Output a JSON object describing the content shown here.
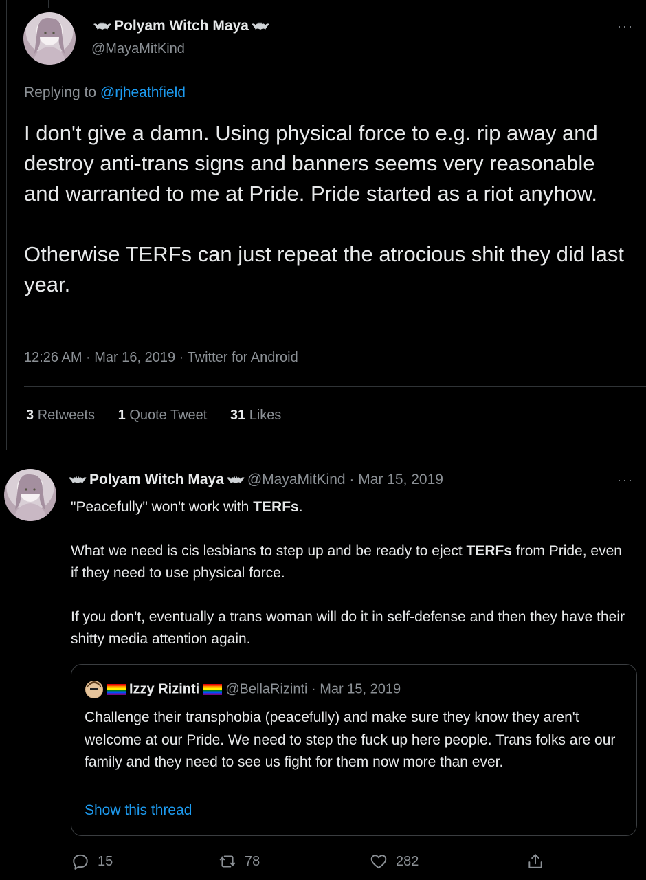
{
  "main_tweet": {
    "display_name": "Polyam Witch Maya",
    "handle": "@MayaMitKind",
    "more_label": "···",
    "replying_to_prefix": "Replying to",
    "replying_to_handle": "@rjheathfield",
    "text_p1": "I don't give a damn. Using physical force to e.g. rip away and destroy anti-trans signs and banners seems very reasonable and warranted to me at Pride. Pride started as a riot anyhow.",
    "text_p2": "Otherwise TERFs can just repeat the atrocious shit they did last year.",
    "meta": "12:26 AM · Mar 16, 2019 · Twitter for Android",
    "stats": {
      "retweets_count": "3",
      "retweets_label": "Retweets",
      "quotes_count": "1",
      "quotes_label": "Quote Tweet",
      "likes_count": "31",
      "likes_label": "Likes"
    }
  },
  "second_tweet": {
    "display_name": "Polyam Witch Maya",
    "handle_date": "@MayaMitKind · Mar 15, 2019",
    "more_label": "···",
    "line1_pre": "\"Peacefully\" won't work with ",
    "line1_bold": "TERFs",
    "line1_post": ".",
    "p2_pre": "What we need is cis lesbians to step up and be ready to eject ",
    "p2_bold": "TERFs",
    "p2_post": " from Pride, even if they need to use physical force.",
    "p3": "If you don't, eventually a trans woman will do it in self-defense and then they have their shitty media attention again.",
    "quote": {
      "name": "Izzy Rizinti",
      "handle_date": "@BellaRizinti · Mar 15, 2019",
      "text": "Challenge their transphobia (peacefully) and make sure they know they aren't welcome at our Pride.  We need to step the fuck up here people. Trans folks are our family and they need to see us fight for them now more than ever.",
      "show_thread": "Show this thread"
    },
    "actions": {
      "replies": "15",
      "retweets": "78",
      "likes": "282"
    }
  },
  "icons": {
    "reply": "reply-icon",
    "retweet": "retweet-icon",
    "like": "heart-icon",
    "share": "share-icon",
    "more": "more-icon"
  },
  "colors": {
    "background": "#000000",
    "text": "#e7e9ea",
    "muted": "#8b9095",
    "link": "#1d9bf0",
    "border": "#2f3336"
  }
}
